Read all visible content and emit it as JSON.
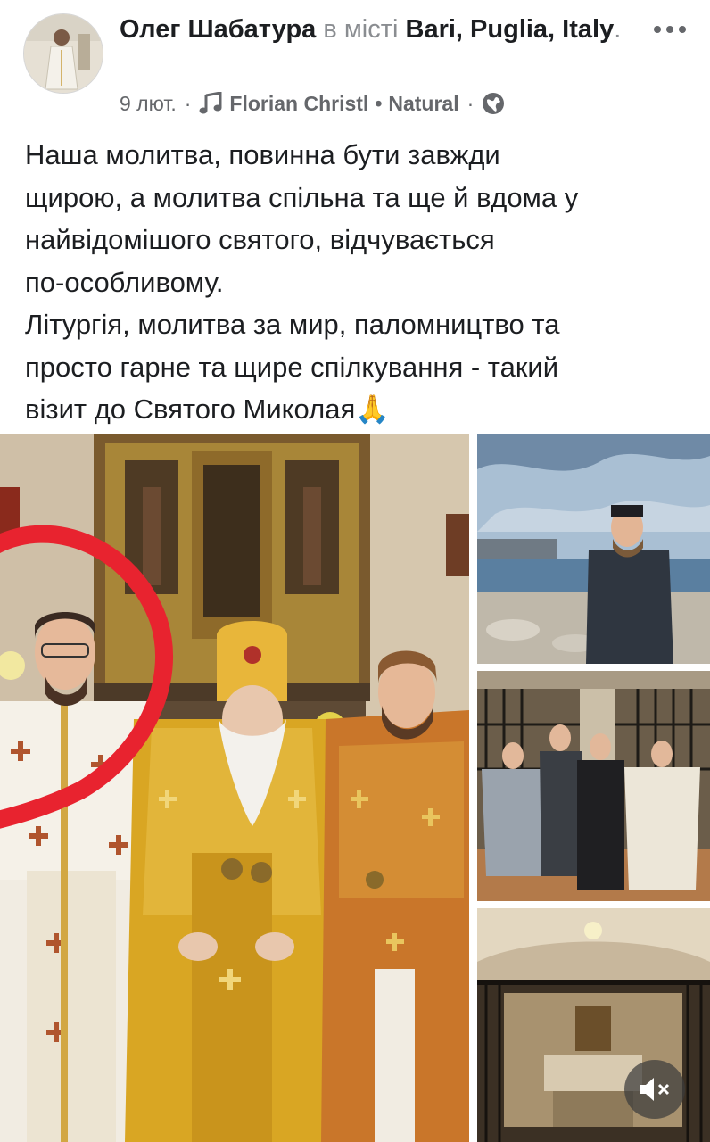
{
  "post": {
    "author": "Олег Шабатура",
    "location_prefix": "в місті",
    "location": "Bari, Puglia, Italy",
    "location_suffix": ".",
    "date": "9 лют.",
    "music_artist": "Florian Christl",
    "music_title": "Natural",
    "meta_separator": "·",
    "privacy_icon": "globe-icon",
    "more_icon": "more-options-icon",
    "text_lines": [
      "Наша молитва, повинна бути завжди",
      "щирою, а молитва спільна та ще й вдома у",
      "найвідомішого святого, відчувається",
      "по-особливому.",
      "Літургія, молитва за мир, паломництво та",
      "просто гарне та щире спілкування - такий",
      "візит до Святого Миколая🙏"
    ]
  },
  "media": {
    "main_photo": "group-photo-clergy-in-vestments",
    "side_photos": [
      "seaside-portrait-photo",
      "group-at-grating-photo",
      "crypt-altar-photo"
    ],
    "mute_icon": "speaker-muted-icon"
  },
  "colors": {
    "text": "#1c1e21",
    "secondary": "#65676b",
    "highlight_circle": "#e8232f",
    "vestment_gold": "#d9a623",
    "vestment_red": "#c9762a"
  }
}
